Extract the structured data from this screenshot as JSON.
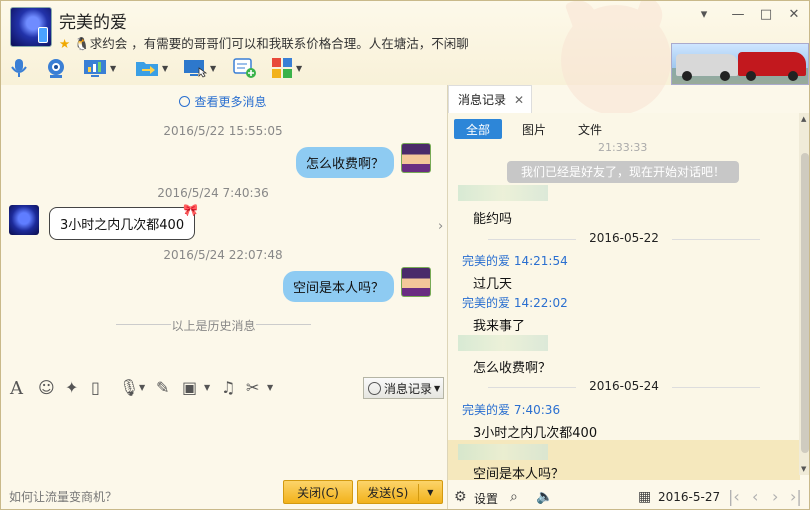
{
  "window": {
    "title": "完美的爱",
    "signature": "求约会 ，有需要的哥哥们可以和我联系价格合理。人在塘沽，不闲聊"
  },
  "chat": {
    "view_more": "查看更多消息",
    "messages": [
      {
        "time": "2016/5/22 15:55:05",
        "text": "怎么收费啊？",
        "from": "me"
      },
      {
        "time": "2016/5/24 7:40:36",
        "text": "3小时之内几次都400",
        "from": "other"
      },
      {
        "time": "2016/5/24 22:07:48",
        "text": "空间是本人吗？",
        "from": "me"
      }
    ],
    "history_divider": "以上是历史消息"
  },
  "input_toolbar": {
    "history_button": "消息记录"
  },
  "bottom": {
    "hint": "如何让流量变商机？",
    "close_button": "关闭(C)",
    "send_button": "发送(S)"
  },
  "history_panel": {
    "tab_label": "消息记录",
    "filters": [
      "全部",
      "图片",
      "文件"
    ],
    "cut_time": "21:33:33",
    "system_message": "我们已经是好友了，现在开始对话吧！",
    "entries": {
      "msg1": "能约吗",
      "date1": "2016-05-22",
      "name1": "完美的爱 14:21:54",
      "msg2": "过几天",
      "name2": "完美的爱 14:22:02",
      "msg3": "我来事了",
      "msg4": "怎么收费啊？",
      "date2": "2016-05-24",
      "name3": "完美的爱 7:40:36",
      "msg5": "3小时之内几次都400",
      "msg6": "空间是本人吗？"
    },
    "footer": {
      "settings": "设置",
      "date": "2016-5-27"
    }
  },
  "colors": {
    "accent_blue": "#2d86d8",
    "bubble_out": "#8ecbf2",
    "button_yellow": "#f2b21b"
  }
}
